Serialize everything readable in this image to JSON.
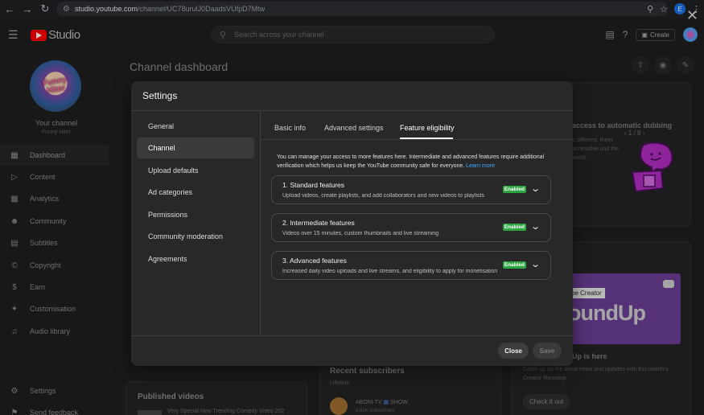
{
  "browser": {
    "url": "studio.youtube.com",
    "url_path": "/channel/UC78urulJ0DaadsVUfpD7Mtw",
    "profile_initial": "E"
  },
  "header": {
    "logo_text": "Studio",
    "search_placeholder": "Search across your channel",
    "create_label": "Create"
  },
  "sidebar": {
    "your_channel": "Your channel",
    "channel_name": "Funny Hiter",
    "avatar_text": "Funny Hiter",
    "items": [
      {
        "label": "Dashboard",
        "icon": "dashboard-icon"
      },
      {
        "label": "Content",
        "icon": "content-icon"
      },
      {
        "label": "Analytics",
        "icon": "analytics-icon"
      },
      {
        "label": "Community",
        "icon": "community-icon"
      },
      {
        "label": "Subtitles",
        "icon": "subtitles-icon"
      },
      {
        "label": "Copyright",
        "icon": "copyright-icon"
      },
      {
        "label": "Earn",
        "icon": "earn-icon"
      },
      {
        "label": "Customisation",
        "icon": "customisation-icon"
      },
      {
        "label": "Audio library",
        "icon": "audio-library-icon"
      }
    ],
    "bottom_items": [
      {
        "label": "Settings",
        "icon": "settings-icon"
      },
      {
        "label": "Send feedback",
        "icon": "feedback-icon"
      }
    ]
  },
  "dashboard": {
    "title": "Channel dashboard",
    "pager": "1 / 8",
    "dubbing_title": "access to automatic dubbing",
    "dubbing_text": "o different. them accessible und the world.",
    "roundup_tag": "be Creator",
    "roundup_big": "oundUp",
    "roundup_title": "Up is here",
    "roundup_text": "Catch up on the latest news and updates with this month's Creator Roundup",
    "roundup_button": "Check it out",
    "recent_subs_title": "Recent subscribers",
    "recent_subs_period": "Lifetime",
    "subscriber_name": "ABONI TV",
    "subscriber_tag": "SHOW",
    "subscriber_count": "5.61K subscribers",
    "published_title": "Published videos",
    "published_video": "Very Special New Trending Comedy Video 202"
  },
  "modal": {
    "title": "Settings",
    "nav": [
      "General",
      "Channel",
      "Upload defaults",
      "Ad categories",
      "Permissions",
      "Community moderation",
      "Agreements"
    ],
    "active_nav": "Channel",
    "tabs": [
      "Basic info",
      "Advanced settings",
      "Feature eligibility"
    ],
    "active_tab": "Feature eligibility",
    "intro": "You can manage your access to more features here. Intermediate and advanced features require additional verification which helps us keep the YouTube community safe for everyone.",
    "learn_more": "Learn more",
    "features": [
      {
        "title": "1. Standard features",
        "desc": "Upload videos, create playlists, and add collaborators and new videos to playlists",
        "status": "Enabled"
      },
      {
        "title": "2. Intermediate features",
        "desc": "Videos over 15 minutes, custom thumbnails and live streaming",
        "status": "Enabled"
      },
      {
        "title": "3. Advanced features",
        "desc": "Increased daily video uploads and live streams, and eligibility to apply for monetisation",
        "status": "Enabled"
      }
    ],
    "close_label": "Close",
    "save_label": "Save"
  },
  "colors": {
    "enabled_badge": "#2ba640",
    "link": "#3ea6ff",
    "brand_red": "#ff0000"
  }
}
